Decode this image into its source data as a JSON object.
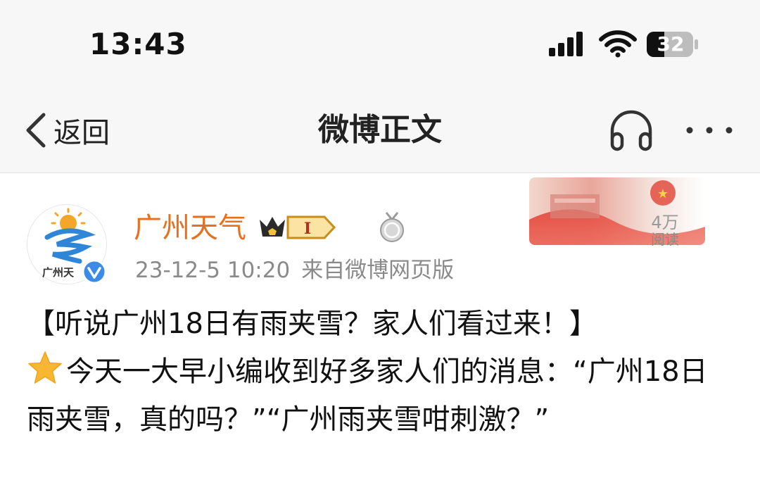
{
  "status_bar": {
    "time": "13:43",
    "battery": "32",
    "icons": [
      "signal-icon",
      "wifi-icon",
      "battery-icon"
    ]
  },
  "nav": {
    "back_label": "返回",
    "title": "微博正文",
    "icons": [
      "chevron-left-icon",
      "headphone-icon",
      "more-icon"
    ]
  },
  "banner": {
    "read_count": "4万",
    "read_label": "阅读"
  },
  "post": {
    "author": {
      "name": "广州天气",
      "avatar_text": "广州天",
      "vip_level": "I"
    },
    "date": "23-12-5 10:20",
    "source": "来自微博网页版",
    "title_line": "【听说广州18日有雨夹雪？家人们看过来！】",
    "body_text": "今天一大早小编收到好多家人们的消息：“广州18日雨夹雪，真的吗？”“广州雨夹雪咁刺激？”"
  },
  "colors": {
    "username": "#e86f1c",
    "meta_gray": "#8a8a8a",
    "bar_bg": "#f7f7f7",
    "verified_blue": "#3d8be8",
    "star": "#f7b731"
  }
}
